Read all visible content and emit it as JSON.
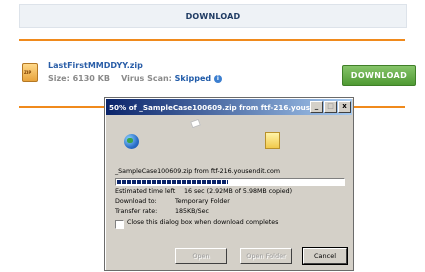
{
  "page": {
    "top_bar_label": "DOWNLOAD",
    "file_name": "LastFirstMMDDYY.zip",
    "size_label": "Size:",
    "size_value": "6130 KB",
    "scan_label": "Virus Scan:",
    "scan_value": "Skipped",
    "download_button": "DOWNLOAD"
  },
  "dialog": {
    "title": "50% of _SampleCase100609.zip from ftf-216.yousen...",
    "title_buttons": [
      "_",
      "□",
      "x"
    ],
    "source_text": "_SampleCase100609.zip from ftf-216.yousendit.com",
    "progress_fraction": 0.49,
    "estimated_label": "Estimated time left",
    "estimated_value": "16 sec (2.92MB of 5.98MB copied)",
    "download_to_label": "Download to:",
    "download_to_value": "Temporary Folder",
    "transfer_rate_label": "Transfer rate:",
    "transfer_rate_value": "185KB/Sec",
    "close_checkbox_label": "Close this dialog box when download completes",
    "buttons": {
      "open": "Open",
      "open_folder": "Open Folder",
      "cancel": "Cancel"
    }
  },
  "colors": {
    "accent_orange": "#f08a1c",
    "download_green": "#4f9a33",
    "title_blue": "#0a246a",
    "progress_blue": "#0a246a"
  }
}
